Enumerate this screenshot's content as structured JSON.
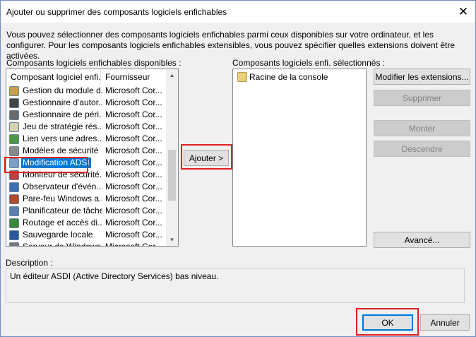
{
  "window": {
    "title": "Ajouter ou supprimer des composants logiciels enfichables",
    "close_glyph": "✕"
  },
  "intro_text": "Vous pouvez sélectionner des composants logiciels enfichables parmi ceux disponibles sur votre ordinateur, et les configurer. Pour les composants logiciels enfichables extensibles, vous pouvez spécifier quelles extensions doivent être activées.",
  "available": {
    "label": "Composants logiciels enfichables disponibles :",
    "columns": [
      "Composant logiciel enfi...",
      "Fournisseur"
    ],
    "rows": [
      {
        "name": "Gestion du module d...",
        "vendor": "Microsoft Cor...",
        "icon": "module-manager-icon",
        "color": "#c9a14a"
      },
      {
        "name": "Gestionnaire d'autor...",
        "vendor": "Microsoft Cor...",
        "icon": "authorization-manager-icon",
        "color": "#444444"
      },
      {
        "name": "Gestionnaire de péri...",
        "vendor": "Microsoft Cor...",
        "icon": "device-manager-icon",
        "color": "#6a6a6a"
      },
      {
        "name": "Jeu de stratégie rés...",
        "vendor": "Microsoft Cor...",
        "icon": "policy-set-icon",
        "color": "#d9d2b0"
      },
      {
        "name": "Lien vers une adres...",
        "vendor": "Microsoft Cor...",
        "icon": "web-link-icon",
        "color": "#4a9a3c"
      },
      {
        "name": "Modèles de sécurité",
        "vendor": "Microsoft Cor...",
        "icon": "security-templates-icon",
        "color": "#8a8a8a"
      },
      {
        "name": "Modification ADSI",
        "vendor": "Microsoft Cor...",
        "icon": "adsi-edit-icon",
        "color": "#7aa0c8",
        "selected": true
      },
      {
        "name": "Moniteur de sécurité...",
        "vendor": "Microsoft Cor...",
        "icon": "security-monitor-icon",
        "color": "#c04040"
      },
      {
        "name": "Observateur d'évén...",
        "vendor": "Microsoft Cor...",
        "icon": "event-viewer-icon",
        "color": "#3a6fb0"
      },
      {
        "name": "Pare-feu Windows a...",
        "vendor": "Microsoft Cor...",
        "icon": "firewall-icon",
        "color": "#b04a2a"
      },
      {
        "name": "Planificateur de tâches",
        "vendor": "Microsoft Cor...",
        "icon": "task-scheduler-icon",
        "color": "#5a7fb0"
      },
      {
        "name": "Routage et accès di...",
        "vendor": "Microsoft Cor...",
        "icon": "routing-icon",
        "color": "#3a8a3a"
      },
      {
        "name": "Sauvegarde locale",
        "vendor": "Microsoft Cor...",
        "icon": "local-backup-icon",
        "color": "#2a5a9a"
      },
      {
        "name": "Serveur de Windows...",
        "vendor": "Microsoft Cor...",
        "icon": "server-icon",
        "color": "#777777"
      }
    ]
  },
  "add_button": "Ajouter >",
  "selected": {
    "label": "Composants logiciels enfi. sélectionnés :",
    "items": [
      {
        "name": "Racine de la console",
        "icon": "folder-icon",
        "color": "#e8d07a"
      }
    ]
  },
  "side_buttons": {
    "modify": "Modifier les extensions...",
    "remove": "Supprimer",
    "up": "Monter",
    "down": "Descendre",
    "advanced": "Avancé..."
  },
  "description": {
    "label": "Description :",
    "text": "Un éditeur ASDI (Active Directory Services) bas niveau."
  },
  "footer": {
    "ok": "OK",
    "cancel": "Annuler"
  },
  "colors": {
    "selection": "#0078d7",
    "highlight_border": "#e02020",
    "default_button_border": "#0078d7"
  }
}
